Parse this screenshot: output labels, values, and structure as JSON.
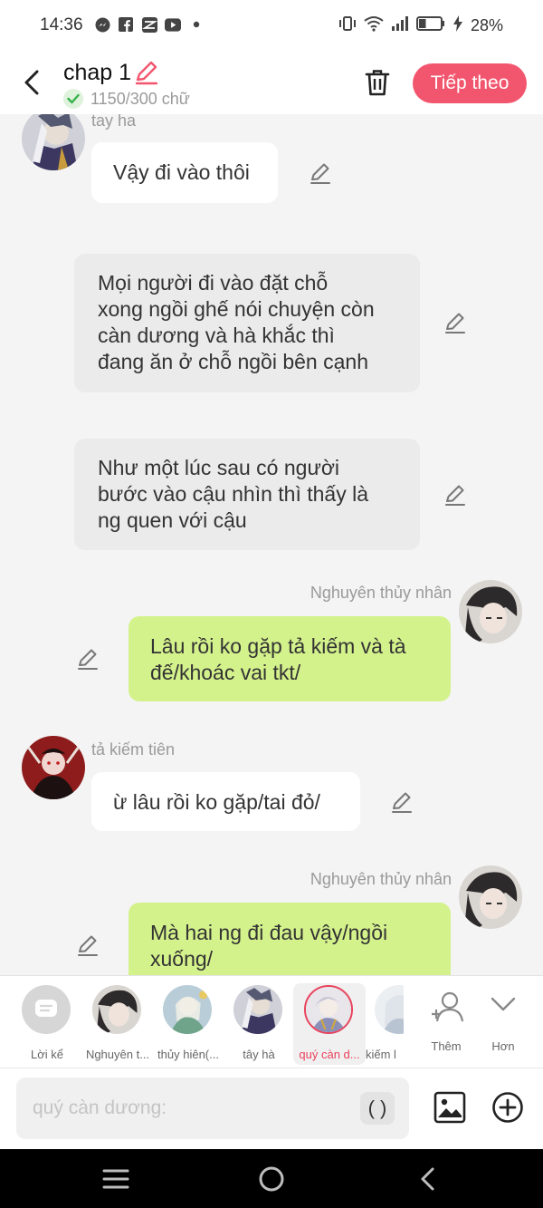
{
  "status_bar": {
    "time": "14:36",
    "battery": "28%"
  },
  "header": {
    "title": "chap 1",
    "word_count": "1150/300 chữ",
    "next_label": "Tiếp theo"
  },
  "messages": [
    {
      "sender": "tay ha",
      "text": "Vậy đi vào thôi"
    },
    {
      "text": "Mọi người đi vào đặt chỗ\nxong ngồi ghế nói chuyện còn\ncàn dương và hà khắc thì\nđang ăn ở chỗ ngồi bên cạnh"
    },
    {
      "text": "Như một lúc sau có người\nbước vào cậu nhìn thì thấy là\nng quen với cậu"
    },
    {
      "sender": "Nghuyên thủy nhân",
      "text": "Lâu rồi ko gặp tả kiếm và tà\nđế/khoác vai tkt/"
    },
    {
      "sender": "tả kiếm tiên",
      "text": "ừ lâu rồi ko gặp/tai đỏ/"
    },
    {
      "sender": "Nghuyên thủy nhân",
      "text": "Mà hai ng đi đau vậy/ngồi\nxuống/"
    }
  ],
  "characters": [
    {
      "label": "Lời kể"
    },
    {
      "label": "Nghuyên t..."
    },
    {
      "label": "thủy hiên(..."
    },
    {
      "label": "tây hà"
    },
    {
      "label": "quý càn d..."
    },
    {
      "label": "kiếm l"
    },
    {
      "label": "Thêm"
    },
    {
      "label": "Hơn"
    }
  ],
  "input": {
    "placeholder": "quý càn dương:",
    "paren_label": "( )"
  },
  "colors": {
    "accent": "#f2566e",
    "green_bubble": "#d4f28c",
    "gray_bubble": "#ebebeb"
  }
}
